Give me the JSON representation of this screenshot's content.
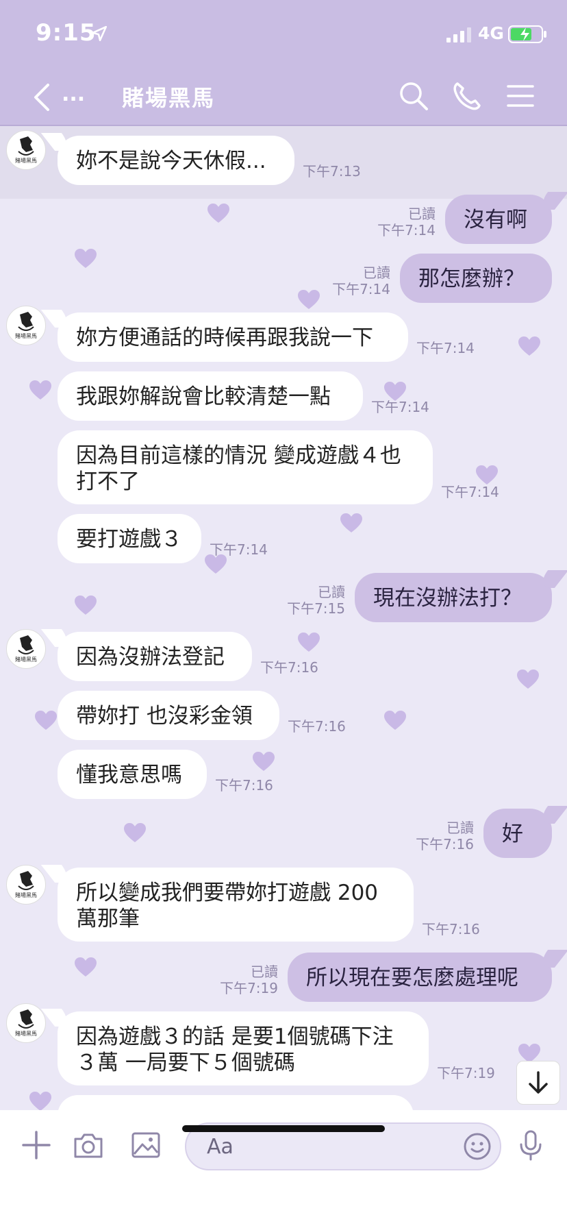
{
  "status_bar": {
    "time": "9:15",
    "network": "4G"
  },
  "header": {
    "title": "賭場黑馬",
    "back_ellipsis": "..."
  },
  "avatar_caption": "賭場黑馬",
  "messages": [
    {
      "text": "妳不是說今天休假...",
      "time": "下午7:13"
    },
    {
      "text": "沒有啊",
      "read": "已讀",
      "time": "下午7:14"
    },
    {
      "text": "那怎麼辦？",
      "read": "已讀",
      "time": "下午7:14"
    },
    {
      "text": "妳方便通話的時候再跟我說一下",
      "time": "下午7:14"
    },
    {
      "text": "我跟妳解說會比較清楚一點",
      "time": "下午7:14"
    },
    {
      "line1": "因為目前這樣的情況 變成遊戲４也",
      "line2": "打不了",
      "time": "下午7:14"
    },
    {
      "text": "要打遊戲３",
      "time": "下午7:14"
    },
    {
      "text": "現在沒辦法打？",
      "read": "已讀",
      "time": "下午7:15"
    },
    {
      "text": "因為沒辦法登記",
      "time": "下午7:16"
    },
    {
      "text": "帶妳打 也沒彩金領",
      "time": "下午7:16"
    },
    {
      "text": "懂我意思嗎",
      "time": "下午7:16"
    },
    {
      "text": "好",
      "read": "已讀",
      "time": "下午7:16"
    },
    {
      "line1": "所以變成我們要帶妳打遊戲 200",
      "line2": "萬那筆",
      "time": "下午7:16"
    },
    {
      "text": "所以現在要怎麼處理呢",
      "read": "已讀",
      "time": "下午7:19"
    },
    {
      "line1": "因為遊戲３的話 是要1個號碼下注",
      "line2": "３萬 一局要下５個號碼",
      "time": "下午7:19"
    }
  ],
  "input": {
    "placeholder": "Aa"
  },
  "colors": {
    "header": "#c9bde3",
    "background": "#ebe8f6",
    "outgoing_bubble": "#cdbfe4",
    "incoming_bubble": "#ffffff"
  },
  "icons": [
    "back-arrow-icon",
    "search-icon",
    "phone-icon",
    "menu-icon",
    "plus-icon",
    "camera-icon",
    "image-icon",
    "emoji-icon",
    "microphone-icon",
    "arrow-down-icon",
    "heart-icon"
  ]
}
